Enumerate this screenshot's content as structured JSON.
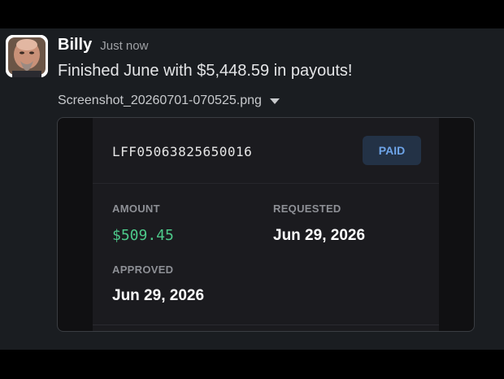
{
  "message": {
    "sender": "Billy",
    "timestamp": "Just now",
    "text": "Finished June with $5,448.59 in payouts!",
    "attachment_name": "Screenshot_20260701-070525.png"
  },
  "payout_card": {
    "invoice_id": "LFF05063825650016",
    "status": "PAID",
    "amount_label": "AMOUNT",
    "amount": "$509.45",
    "requested_label": "REQUESTED",
    "requested_date": "Jun 29, 2026",
    "approved_label": "APPROVED",
    "approved_date": "Jun 29, 2026"
  },
  "colors": {
    "background": "#1a1d21",
    "amount_green": "#4dc98a",
    "paid_badge_bg": "#233246",
    "paid_badge_text": "#6ea4e8"
  }
}
